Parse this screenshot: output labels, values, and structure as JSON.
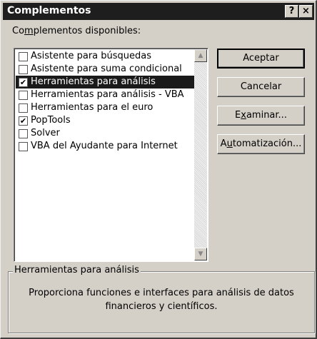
{
  "window": {
    "title": "Complementos",
    "help_label": "?",
    "close_label": "×"
  },
  "addins": {
    "label_pre": "Co",
    "label_accel": "m",
    "label_post": "plementos disponibles:",
    "items": [
      {
        "label": "Asistente para búsquedas",
        "checked": false,
        "selected": false
      },
      {
        "label": "Asistente para suma condicional",
        "checked": false,
        "selected": false
      },
      {
        "label": "Herramientas para análisis",
        "checked": true,
        "selected": true
      },
      {
        "label": "Herramientas para análisis - VBA",
        "checked": false,
        "selected": false
      },
      {
        "label": "Herramientas para el euro",
        "checked": false,
        "selected": false
      },
      {
        "label": "PopTools",
        "checked": true,
        "selected": false
      },
      {
        "label": "Solver",
        "checked": false,
        "selected": false
      },
      {
        "label": "VBA del Ayudante para Internet",
        "checked": false,
        "selected": false
      }
    ],
    "check_glyph": "✔"
  },
  "buttons": {
    "ok": "Aceptar",
    "cancel": "Cancelar",
    "browse_pre": "E",
    "browse_accel": "x",
    "browse_post": "aminar...",
    "automation_pre": "A",
    "automation_accel": "u",
    "automation_post": "tomatización..."
  },
  "description": {
    "title": "Herramientas para análisis",
    "text_line1": "Proporciona funciones e interfaces para análisis de datos",
    "text_line2": "financieros y científicos."
  },
  "scroll": {
    "up_glyph": "▲",
    "down_glyph": "▼"
  }
}
